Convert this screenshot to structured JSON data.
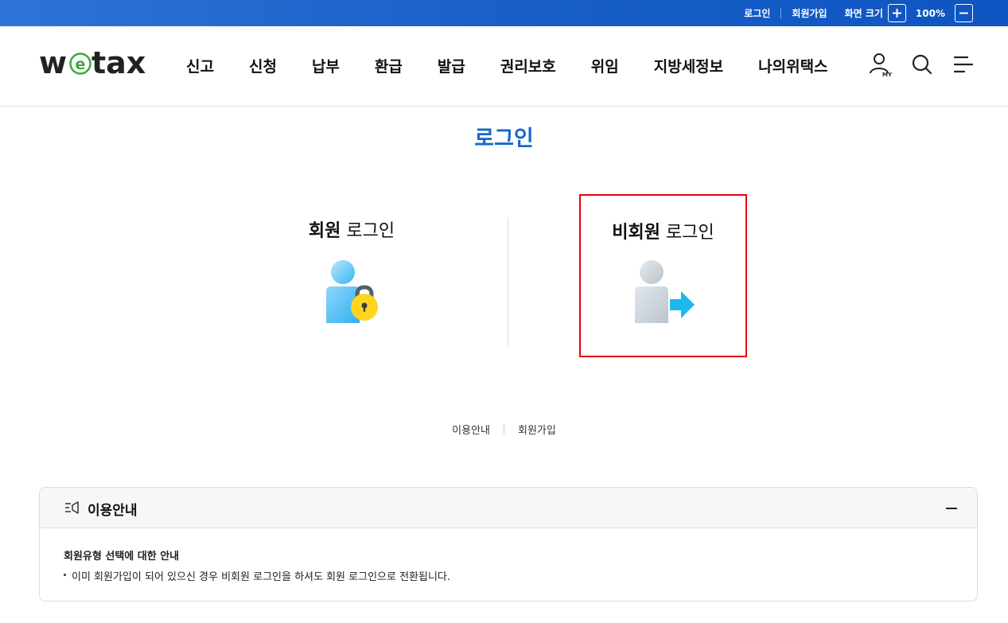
{
  "topbar": {
    "login": "로그인",
    "signup": "회원가입",
    "zoom_label": "화면 크기",
    "zoom_in": "+",
    "zoom_value": "100%",
    "zoom_out": "−"
  },
  "header": {
    "logo": "wetax",
    "logo_prefix": "w",
    "logo_e": "e",
    "logo_suffix": "tax",
    "nav": [
      "신고",
      "신청",
      "납부",
      "환급",
      "발급",
      "권리보호",
      "위임",
      "지방세정보",
      "나의위택스"
    ],
    "my_label": "MY",
    "icons": [
      "my-page-icon",
      "search-icon",
      "menu-icon"
    ]
  },
  "page": {
    "title": "로그인"
  },
  "login": {
    "member": {
      "strong": "회원",
      "rest": "로그인"
    },
    "guest": {
      "strong": "비회원",
      "rest": "로그인"
    }
  },
  "sublinks": [
    "이용안내",
    "회원가입"
  ],
  "info": {
    "title": "이용안내",
    "body_title": "회원유형 선택에 대한 안내",
    "body_text": "이미 회원가입이 되어 있으신 경우 비회원 로그인을 하셔도 회원 로그인으로 전환됩니다."
  },
  "colors": {
    "topbar": "#1a5fc8",
    "title": "#1a66c8",
    "highlight_border": "#e60012",
    "logo_green": "#3aaa35"
  }
}
